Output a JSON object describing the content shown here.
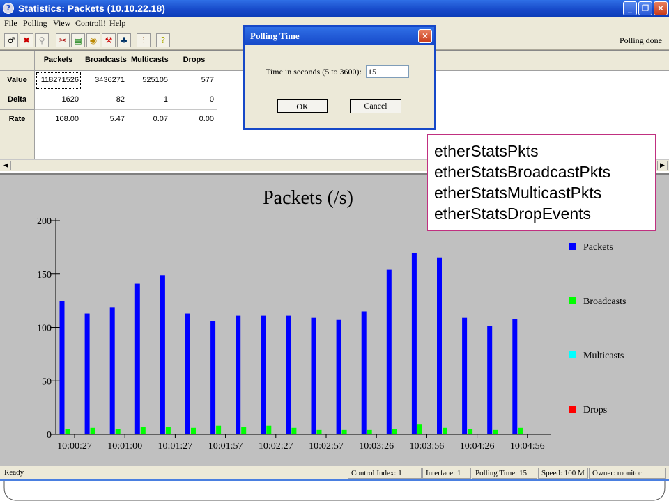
{
  "window": {
    "title": "Statistics: Packets (10.10.22.18)",
    "app_icon": "?"
  },
  "menu": [
    "File",
    "Polling",
    "View",
    "Controll!",
    "Help"
  ],
  "toolbar": {
    "icons": [
      "probe-icon",
      "cancel-icon",
      "search-icon",
      "delete-icon",
      "document-icon",
      "stats-icon",
      "tools-icon",
      "chart-icon",
      "filter-icon",
      "help-icon"
    ],
    "status": "Polling done"
  },
  "grid": {
    "columns": [
      "Packets",
      "Broadcasts",
      "Multicasts",
      "Drops"
    ],
    "rows": [
      {
        "label": "Value",
        "cells": [
          "118271526",
          "3436271",
          "525105",
          "577"
        ]
      },
      {
        "label": "Delta",
        "cells": [
          "1620",
          "82",
          "1",
          "0"
        ]
      },
      {
        "label": "Rate",
        "cells": [
          "108.00",
          "5.47",
          "0.07",
          "0.00"
        ]
      }
    ]
  },
  "dialog": {
    "title": "Polling Time",
    "label": "Time in seconds (5 to 3600):",
    "value": "15",
    "ok": "OK",
    "cancel": "Cancel"
  },
  "annotation": [
    "etherStatsPkts",
    "etherStatsBroadcastPkts",
    "etherStatsMulticastPkts",
    "etherStatsDropEvents"
  ],
  "chart_data": {
    "type": "bar",
    "title": "Packets (/s)",
    "xlabel": "",
    "ylabel": "",
    "ylim": [
      0,
      200
    ],
    "yticks": [
      0,
      50,
      100,
      150,
      200
    ],
    "x_tick_labels": [
      "10:00:27",
      "10:01:00",
      "10:01:27",
      "10:01:57",
      "10:02:27",
      "10:02:57",
      "10:03:26",
      "10:03:56",
      "10:04:26",
      "10:04:56"
    ],
    "series": [
      {
        "name": "Packets",
        "color": "#0000ff",
        "values": [
          125,
          113,
          119,
          141,
          149,
          113,
          106,
          111,
          111,
          111,
          109,
          107,
          115,
          154,
          170,
          165,
          109,
          101,
          108
        ]
      },
      {
        "name": "Broadcasts",
        "color": "#00ff00",
        "values": [
          5,
          6,
          5,
          7,
          7,
          6,
          8,
          7,
          8,
          6,
          4,
          4,
          4,
          5,
          9,
          6,
          5,
          4,
          6
        ]
      },
      {
        "name": "Multicasts",
        "color": "#00ffff",
        "values": [
          0,
          0,
          0,
          0,
          0,
          0,
          0,
          0,
          0,
          0,
          0,
          0,
          0,
          0,
          0,
          0,
          0,
          0,
          0
        ]
      },
      {
        "name": "Drops",
        "color": "#ff0000",
        "values": [
          0,
          0,
          0,
          0,
          0,
          0,
          0,
          0,
          0,
          0,
          0,
          0,
          0,
          0,
          0,
          0,
          0,
          0,
          0
        ]
      }
    ],
    "legend_position": "right"
  },
  "statusbar": {
    "message": "Ready",
    "control_index": "Control Index: 1",
    "interface": "Interface: 1",
    "polling_time": "Polling Time: 15",
    "speed": "Speed: 100 M",
    "owner": "Owner: monitor"
  }
}
